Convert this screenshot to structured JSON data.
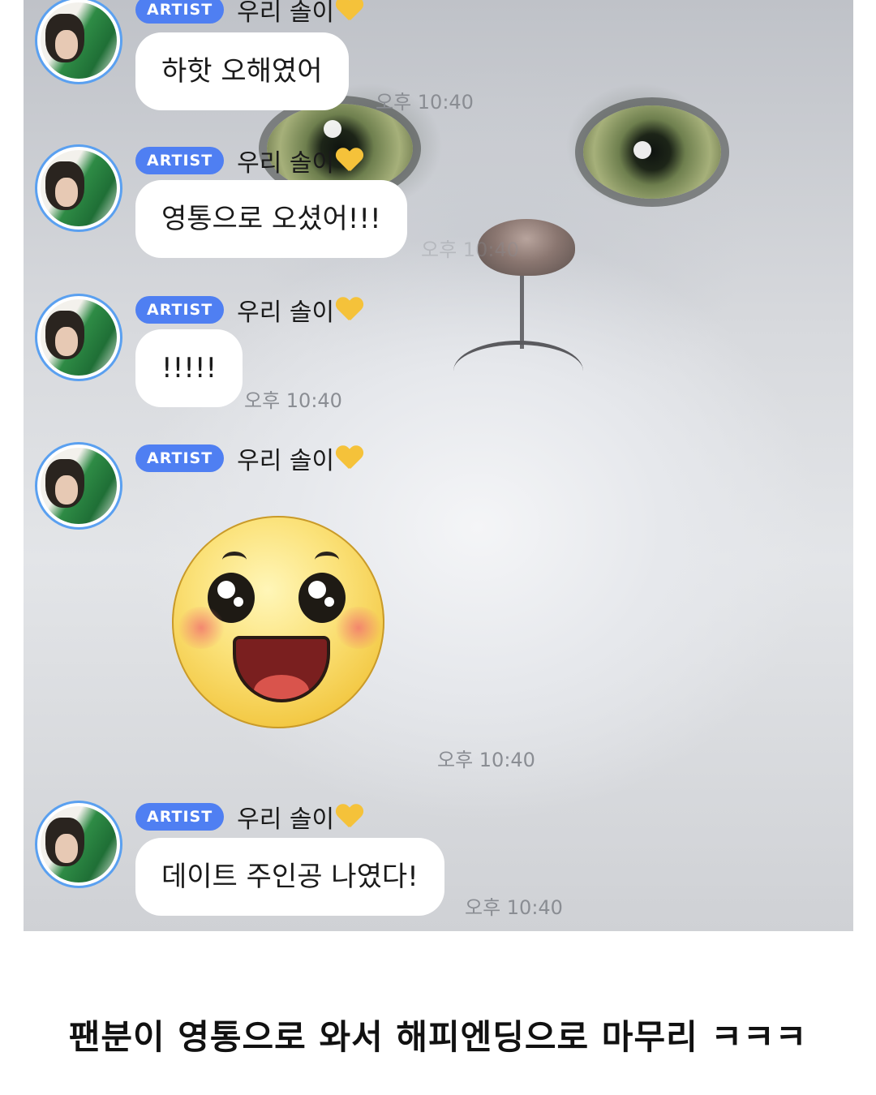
{
  "chat": {
    "badge_label": "ARTIST",
    "sender_name": "우리 솔이",
    "messages": [
      {
        "text": "하핫 오해였어",
        "time": "오후 10:40"
      },
      {
        "text": "영통으로 오셨어!!!",
        "time": "오후 10:40"
      },
      {
        "text": "!!!!!",
        "time": "오후 10:40"
      },
      {
        "text": "",
        "time": "오후 10:40",
        "sticker": "smiling-face-sticker"
      },
      {
        "text": "데이트 주인공 나였다!",
        "time": "오후 10:40"
      }
    ]
  },
  "caption": "팬분이 영통으로 와서 해피엔딩으로 마무리 ㅋㅋㅋ"
}
